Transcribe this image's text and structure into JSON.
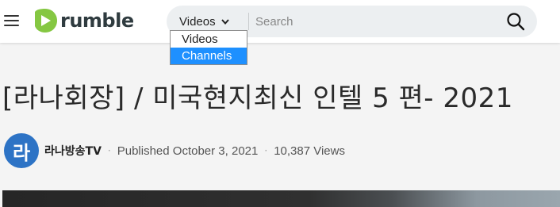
{
  "header": {
    "logo_text": "rumble",
    "brand_color": "#85c742",
    "search": {
      "category_selected": "Videos",
      "placeholder": "Search",
      "options": [
        "Videos",
        "Channels"
      ],
      "highlighted_option": "Channels",
      "highlight_color": "#1e90ff"
    },
    "icons": {
      "menu": "hamburger-menu-icon",
      "search": "search-icon",
      "dropdown": "chevron-down-icon"
    }
  },
  "video": {
    "title": "[라나회장] / 미국현지최신 인텔 5 편- 2021",
    "channel": {
      "avatar_text": "라",
      "avatar_color": "#2d73c5",
      "name": "라나방송TV"
    },
    "published": "Published October 3, 2021",
    "views": "10,387 Views",
    "separator": "·"
  }
}
